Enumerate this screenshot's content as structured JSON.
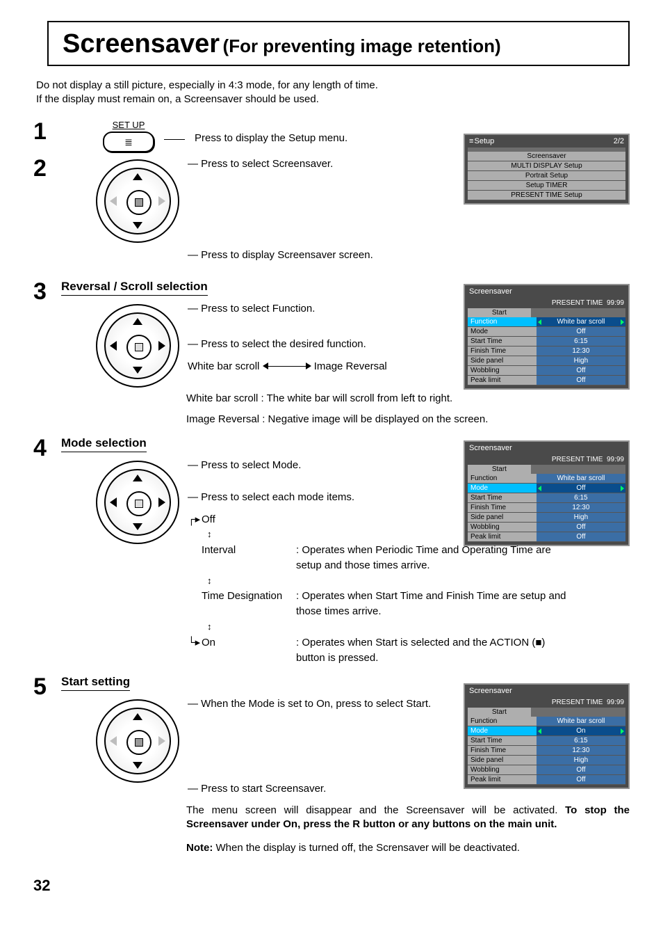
{
  "title": {
    "main": "Screensaver",
    "sub": "(For preventing image retention)"
  },
  "intro": "Do not display a still picture, especially in 4:3 mode, for any length of time.\nIf the display must remain on, a Screensaver should be used.",
  "step1": {
    "num": "1",
    "setup_label": "SET UP",
    "text": "Press to display the Setup menu."
  },
  "step2": {
    "num": "2",
    "text_top": "Press to select Screensaver.",
    "text_bottom": "Press to display Screensaver screen."
  },
  "step3": {
    "num": "3",
    "heading": "Reversal / Scroll selection",
    "line1": "Press to select Function.",
    "line2": "Press to select the desired function.",
    "opt_left": "White bar scroll",
    "opt_right": "Image Reversal",
    "expl1": "White bar scroll : The white bar will scroll from left to right.",
    "expl2": "Image Reversal : Negative image will be displayed on the screen."
  },
  "step4": {
    "num": "4",
    "heading": "Mode selection",
    "line1": "Press to select Mode.",
    "line2": "Press to select each mode items.",
    "seq": [
      "Off",
      "Interval",
      "Time Designation",
      "On"
    ],
    "desc_interval": ": Operates when Periodic Time and Operating Time are setup and those times arrive.",
    "desc_time": ": Operates when Start Time and Finish Time are setup and those times arrive.",
    "desc_on": ": Operates when Start is selected and the ACTION (■) button is pressed."
  },
  "step5": {
    "num": "5",
    "heading": "Start setting",
    "line1": "When the Mode is set to On, press to select Start.",
    "line2": "Press to start Screensaver.",
    "body": "The menu screen will disappear and the Screensaver will be activated. ",
    "body_bold": "To stop the Screensaver under On, press the R button or any buttons on the main unit.",
    "note_label": "Note:",
    "note_text": " When the display is turned off, the Scrensaver will be deactivated."
  },
  "setup_menu": {
    "title": "Setup",
    "page": "2/2",
    "items": [
      "Screensaver",
      "MULTI DISPLAY Setup",
      "Portrait Setup",
      "Setup TIMER",
      "PRESENT TIME Setup"
    ]
  },
  "ss_common": {
    "title": "Screensaver",
    "present_label": "PRESENT  TIME",
    "present_value": "99:99",
    "start": "Start",
    "rows": {
      "function": "Function",
      "mode": "Mode",
      "start_time": "Start Time",
      "finish_time": "Finish Time",
      "side_panel": "Side panel",
      "wobbling": "Wobbling",
      "peak_limit": "Peak limit"
    },
    "vals": {
      "function": "White bar scroll",
      "start_time": "6:15",
      "finish_time": "12:30",
      "side_panel": "High",
      "wobbling": "Off",
      "peak_limit": "Off"
    }
  },
  "ss_menu3": {
    "mode": "Off",
    "active": "function"
  },
  "ss_menu4": {
    "mode": "Off",
    "active": "mode"
  },
  "ss_menu5": {
    "mode": "On",
    "active": "mode"
  },
  "pagenum": "32"
}
